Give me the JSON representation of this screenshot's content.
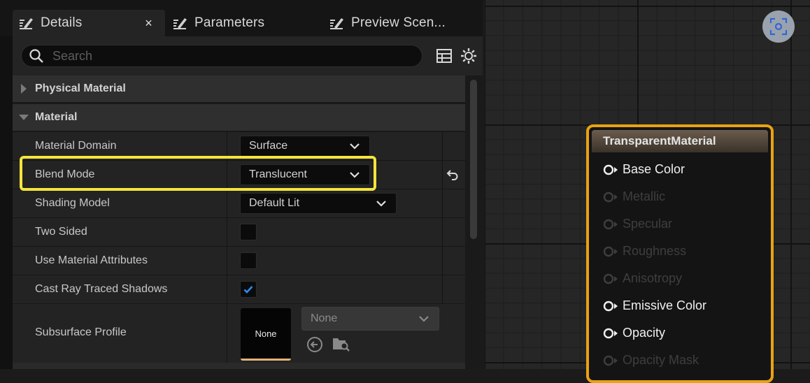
{
  "tabs": [
    {
      "label": "Details",
      "close": "×",
      "icon": "pencil-grid-icon"
    },
    {
      "label": "Parameters",
      "icon": "pencil-grid-icon"
    },
    {
      "label": "Preview Scen...",
      "icon": "pencil-grid-icon"
    }
  ],
  "search": {
    "placeholder": "Search"
  },
  "categories": {
    "physical": {
      "label": "Physical Material"
    },
    "material": {
      "label": "Material"
    }
  },
  "properties": {
    "material_domain": {
      "label": "Material Domain",
      "value": "Surface"
    },
    "blend_mode": {
      "label": "Blend Mode",
      "value": "Translucent"
    },
    "shading_model": {
      "label": "Shading Model",
      "value": "Default Lit"
    },
    "two_sided": {
      "label": "Two Sided",
      "checked": false
    },
    "use_material_attributes": {
      "label": "Use Material Attributes",
      "checked": false
    },
    "cast_ray_traced_shadows": {
      "label": "Cast Ray Traced Shadows",
      "checked": true
    },
    "subsurface_profile": {
      "label": "Subsurface Profile",
      "thumbnail": "None",
      "value": "None"
    }
  },
  "node": {
    "title": "TransparentMaterial",
    "pins": [
      {
        "label": "Base Color",
        "active": true
      },
      {
        "label": "Metallic",
        "active": false
      },
      {
        "label": "Specular",
        "active": false
      },
      {
        "label": "Roughness",
        "active": false
      },
      {
        "label": "Anisotropy",
        "active": false
      },
      {
        "label": "Emissive Color",
        "active": true
      },
      {
        "label": "Opacity",
        "active": true
      },
      {
        "label": "Opacity Mask",
        "active": false
      }
    ]
  },
  "colors": {
    "highlight": "#f4e53b",
    "node_border": "#e8a213",
    "check_accent": "#2b8cf0"
  }
}
